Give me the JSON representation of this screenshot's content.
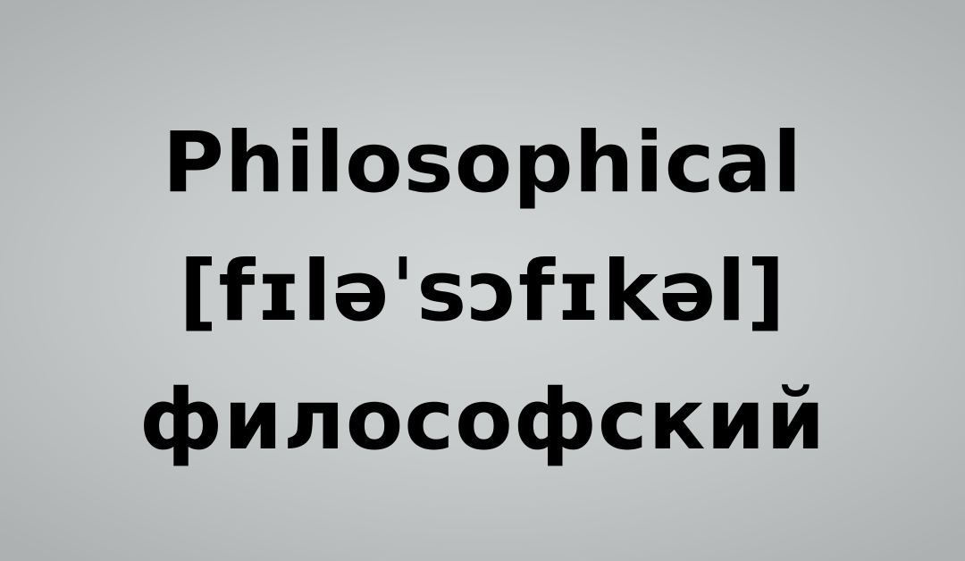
{
  "card": {
    "word": "Philosophical",
    "transcription": "[fɪləˈsɔfɪkəl]",
    "translation": "философский"
  },
  "colors": {
    "background": "#c9cdcd",
    "text": "#000000"
  }
}
